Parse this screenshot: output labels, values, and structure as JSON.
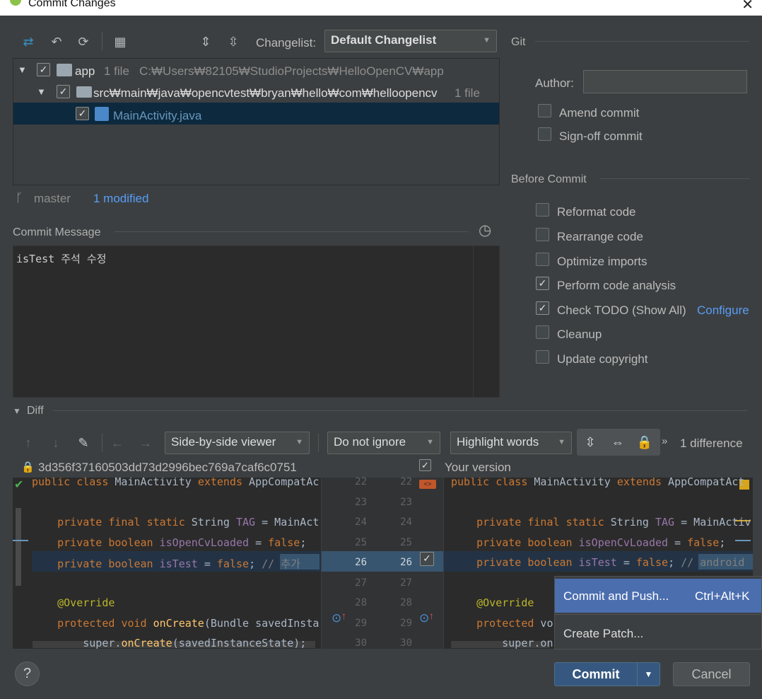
{
  "window": {
    "title": "Commit Changes"
  },
  "toolbar": {
    "changelist_label": "Changelist:",
    "changelist_value": "Default Changelist"
  },
  "tree": {
    "root": {
      "name": "app",
      "count": "1 file",
      "path": "C:₩Users₩82105₩StudioProjects₩HelloOpenCV₩app"
    },
    "folder": {
      "name": "src₩main₩java₩opencvtest₩bryan₩hello₩com₩helloopencv",
      "count": "1 file"
    },
    "file": {
      "name": "MainActivity.java"
    }
  },
  "status": {
    "branch": "master",
    "modified": "1 modified"
  },
  "commit_message": {
    "header": "Commit Message",
    "text": "isTest 주석 수정"
  },
  "git": {
    "header": "Git",
    "author_label": "Author:",
    "author_value": "",
    "amend": "Amend commit",
    "signoff": "Sign-off commit"
  },
  "before_commit": {
    "header": "Before Commit",
    "options": [
      {
        "label": "Reformat code",
        "checked": false
      },
      {
        "label": "Rearrange code",
        "checked": false
      },
      {
        "label": "Optimize imports",
        "checked": false
      },
      {
        "label": "Perform code analysis",
        "checked": true
      },
      {
        "label": "Check TODO (Show All)",
        "checked": true,
        "link": "Configure"
      },
      {
        "label": "Cleanup",
        "checked": false
      },
      {
        "label": "Update copyright",
        "checked": false
      }
    ]
  },
  "diff": {
    "header": "Diff",
    "viewer": "Side-by-side viewer",
    "ignore": "Do not ignore",
    "highlight": "Highlight words",
    "more": "»",
    "difference_count": "1 difference",
    "left_title": "3d356f37160503dd73d2996bec769a7caf6c0751",
    "right_title": "Your version",
    "line_numbers": [
      "22",
      "23",
      "24",
      "25",
      "26",
      "27",
      "28",
      "29",
      "30"
    ],
    "left_lines": [
      "public class MainActivity extends AppCompatAc",
      "",
      "    private final static String TAG = MainAct",
      "    private boolean isOpenCvLoaded = false;",
      "    private boolean isTest = false; // 추가 ",
      "",
      "    @Override",
      "    protected void onCreate(Bundle savedInsta",
      "        super.onCreate(savedInstanceState);"
    ],
    "right_lines": [
      "public class MainActivity extends AppCompatAct",
      "",
      "    private final static String TAG = MainActiv",
      "    private boolean isOpenCvLoaded = false;",
      "    private boolean isTest = false; // android ",
      "",
      "    @Override",
      "    protected vo",
      "        super.on"
    ]
  },
  "popup": {
    "items": [
      {
        "label": "Commit and Push...",
        "shortcut": "Ctrl+Alt+K"
      },
      {
        "label": "Create Patch...",
        "shortcut": ""
      }
    ]
  },
  "buttons": {
    "help": "?",
    "commit": "Commit",
    "cancel": "Cancel"
  },
  "colors": {
    "selection": "#0d293e",
    "accent": "#365880",
    "link": "#589df6",
    "diff_changed": "#385570"
  }
}
